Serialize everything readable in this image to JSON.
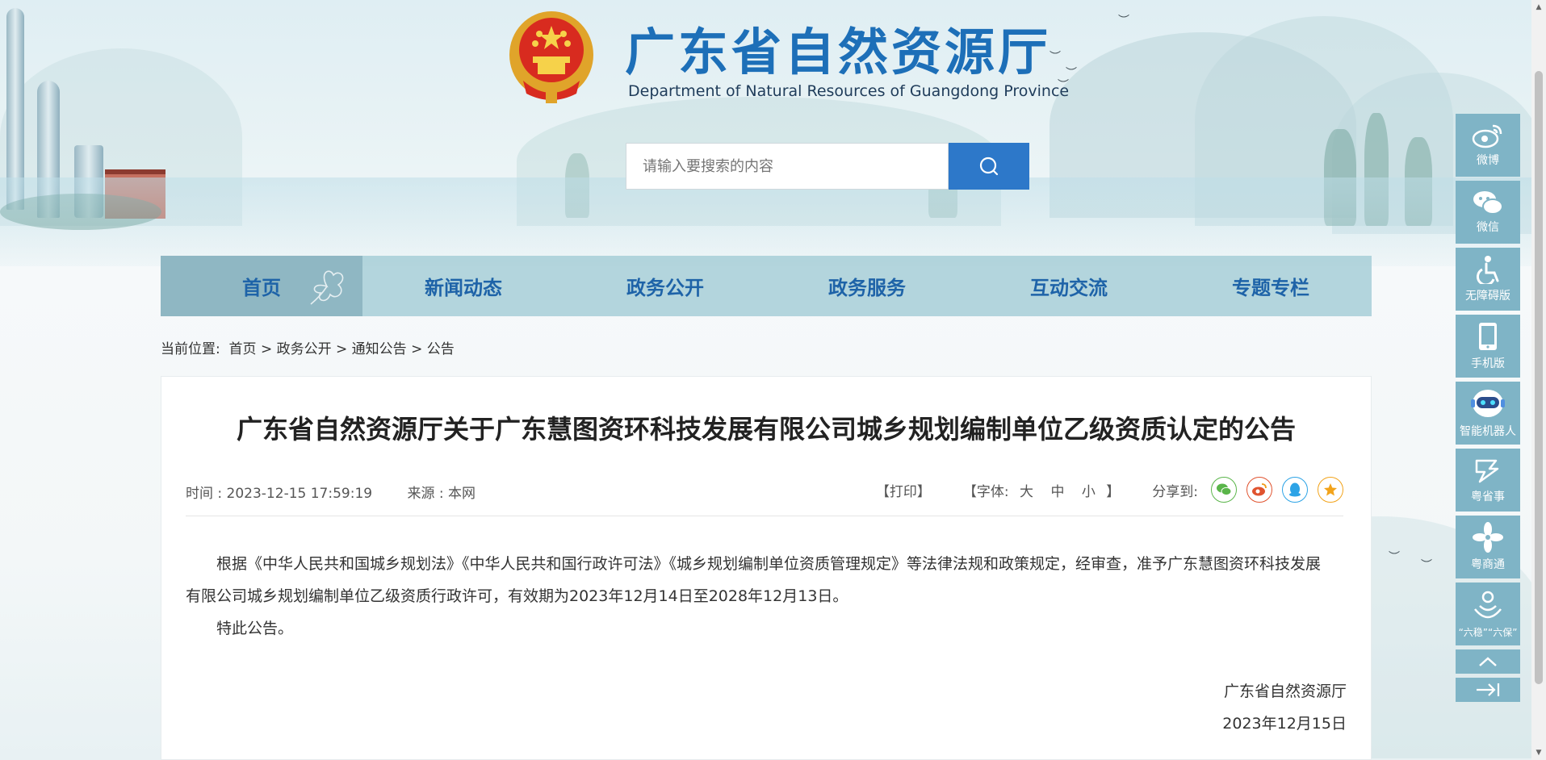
{
  "header": {
    "site_title": "广东省自然资源厅",
    "site_subtitle": "Department of Natural Resources of Guangdong Province"
  },
  "search": {
    "placeholder": "请输入要搜索的内容"
  },
  "nav": {
    "items": [
      {
        "label": "首页"
      },
      {
        "label": "新闻动态"
      },
      {
        "label": "政务公开"
      },
      {
        "label": "政务服务"
      },
      {
        "label": "互动交流"
      },
      {
        "label": "专题专栏"
      }
    ]
  },
  "breadcrumb": {
    "prefix": "当前位置:",
    "items": [
      "首页",
      "政务公开",
      "通知公告",
      "公告"
    ],
    "separator": ">"
  },
  "article": {
    "title": "广东省自然资源厅关于广东慧图资环科技发展有限公司城乡规划编制单位乙级资质认定的公告",
    "time_label": "时间 : 2023-12-15 17:59:19",
    "source_label": "来源 : 本网",
    "print_label": "【打印】",
    "font_label": "【字体:",
    "font_large": "大",
    "font_medium": "中",
    "font_small": "小",
    "font_close": "】",
    "share_label": "分享到:",
    "paragraphs": [
      "根据《中华人民共和国城乡规划法》《中华人民共和国行政许可法》《城乡规划编制单位资质管理规定》等法律法规和政策规定，经审查，准予广东慧图资环科技发展有限公司城乡规划编制单位乙级资质行政许可，有效期为2023年12月14日至2028年12月13日。",
      "特此公告。"
    ],
    "signature_org": "广东省自然资源厅",
    "signature_date": "2023年12月15日"
  },
  "float_bar": {
    "items": [
      {
        "label": "微博",
        "icon": "weibo-icon"
      },
      {
        "label": "微信",
        "icon": "wechat-icon"
      },
      {
        "label": "无障碍版",
        "icon": "accessibility-icon"
      },
      {
        "label": "手机版",
        "icon": "mobile-icon"
      },
      {
        "label": "智能机器人",
        "icon": "robot-icon"
      },
      {
        "label": "粤省事",
        "icon": "yueshengshi-icon"
      },
      {
        "label": "粤商通",
        "icon": "yueshangtong-icon"
      },
      {
        "label": "“六稳”“六保”",
        "icon": "six-stability-icon"
      }
    ]
  },
  "colors": {
    "brand_blue": "#1d6fb8",
    "nav_bg": "#a0cad5",
    "float_bg": "#7fb4c6",
    "search_btn": "#2d78c9"
  }
}
